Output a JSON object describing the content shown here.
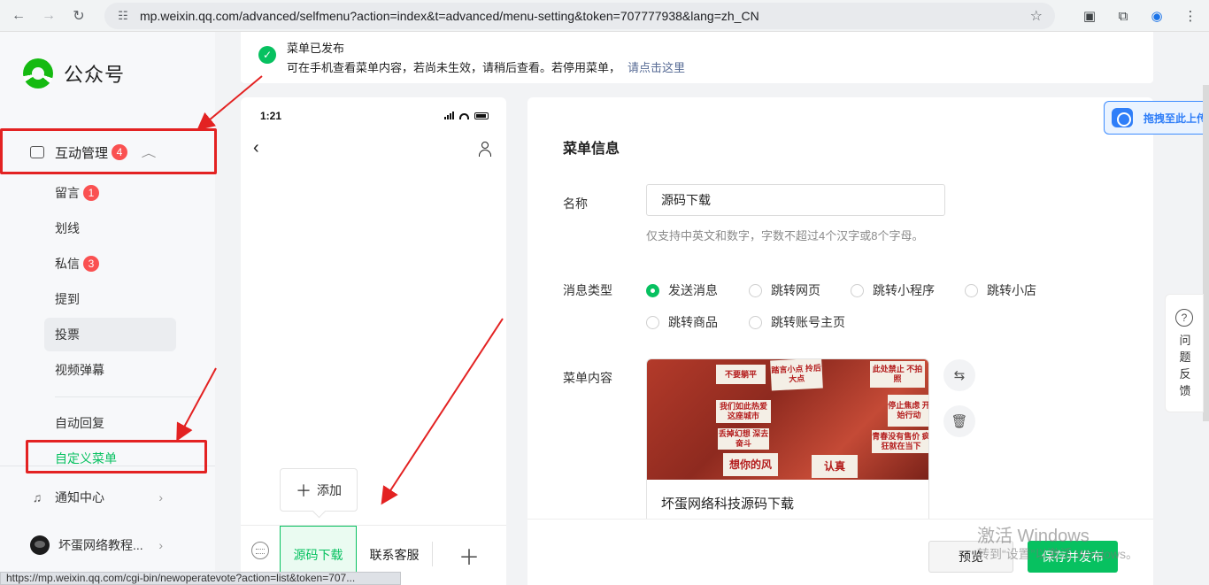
{
  "browser": {
    "url": "mp.weixin.qq.com/advanced/selfmenu?action=index&t=advanced/menu-setting&token=707777938&lang=zh_CN",
    "status_url": "https://mp.weixin.qq.com/cgi-bin/newoperatevote?action=list&token=707..."
  },
  "sidebar": {
    "logo_text": "公众号",
    "group": {
      "label": "互动管理",
      "badge": "4"
    },
    "items": [
      {
        "label": "留言",
        "badge": "1"
      },
      {
        "label": "划线"
      },
      {
        "label": "私信",
        "badge": "3"
      },
      {
        "label": "提到"
      },
      {
        "label": "投票"
      },
      {
        "label": "视频弹幕"
      },
      {
        "label": "自动回复"
      },
      {
        "label": "自定义菜单"
      }
    ],
    "notice_center": "通知中心",
    "account_name": "坏蛋网络教程..."
  },
  "notice": {
    "title": "菜单已发布",
    "text": "可在手机查看菜单内容，若尚未生效，请稍后查看。若停用菜单，",
    "link": "请点击这里"
  },
  "phone": {
    "time": "1:21",
    "add_label": "添加",
    "menu_items": [
      "源码下载",
      "联系客服"
    ]
  },
  "panel": {
    "title": "菜单信息",
    "name_label": "名称",
    "name_value": "源码下载",
    "name_hint": "仅支持中英文和数字，字数不超过4个汉字或8个字母。",
    "type_label": "消息类型",
    "types": [
      "发送消息",
      "跳转网页",
      "跳转小程序",
      "跳转小店",
      "跳转商品",
      "跳转账号主页"
    ],
    "selected_type": "发送消息",
    "content_label": "菜单内容",
    "card_caption": "坏蛋网络科技源码下载",
    "card_notes": [
      "不要躺平",
      "踏言小点 拎后大点",
      "此处禁止 不拍照",
      "我们如此热爱 这座城市",
      "停止焦虑 开始行动",
      "丢掉幻想 深去奋斗",
      "想你的风",
      "青春没有售价 疯狂就在当下",
      "认真"
    ]
  },
  "footer": {
    "preview": "预览",
    "save": "保存并发布"
  },
  "overlay": {
    "baidu": "拖拽至此上传",
    "feedback": "问题反馈",
    "watermark1": "激活 Windows",
    "watermark2": "转到“设置”以激活 Windows。"
  },
  "colors": {
    "accent": "#07c160",
    "badge": "#fa5151",
    "annotation": "#e32222",
    "link": "#576b95"
  }
}
